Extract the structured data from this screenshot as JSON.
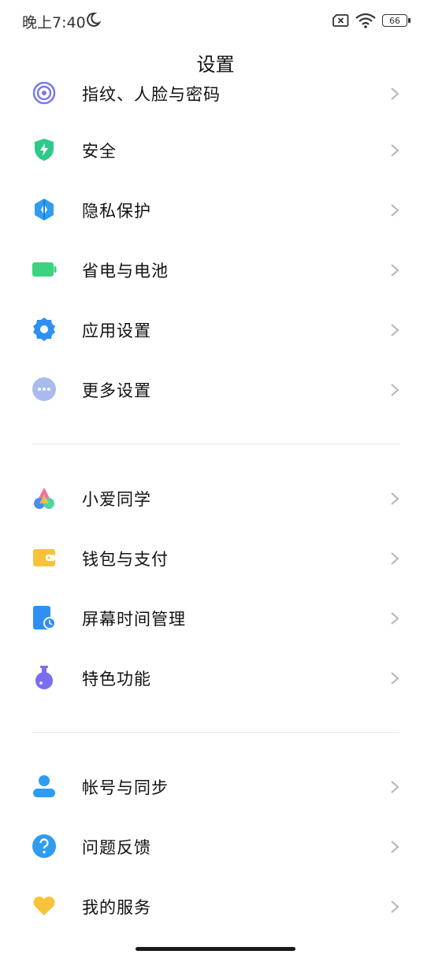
{
  "status_bar": {
    "time": "晚上7:40",
    "battery": "66"
  },
  "header": {
    "title": "设置"
  },
  "groups": [
    {
      "items": [
        {
          "label": "指纹、人脸与密码",
          "icon": "fingerprint-icon",
          "color": "#7a79e6"
        },
        {
          "label": "安全",
          "icon": "shield-icon",
          "color": "#2fc98a"
        },
        {
          "label": "隐私保护",
          "icon": "privacy-icon",
          "color": "#2f9cf0"
        },
        {
          "label": "省电与电池",
          "icon": "battery-icon",
          "color": "#3cd27f"
        },
        {
          "label": "应用设置",
          "icon": "gear-icon",
          "color": "#2f8ff2"
        },
        {
          "label": "更多设置",
          "icon": "more-icon",
          "color": "#9fb4ec"
        }
      ]
    },
    {
      "items": [
        {
          "label": "小爱同学",
          "icon": "xiaoai-icon",
          "color": "#5b8cf5"
        },
        {
          "label": "钱包与支付",
          "icon": "wallet-icon",
          "color": "#f9c23c"
        },
        {
          "label": "屏幕时间管理",
          "icon": "screen-time-icon",
          "color": "#2f8ff2"
        },
        {
          "label": "特色功能",
          "icon": "flask-icon",
          "color": "#7b6cf0"
        }
      ]
    },
    {
      "items": [
        {
          "label": "帐号与同步",
          "icon": "account-icon",
          "color": "#2f9cf0"
        },
        {
          "label": "问题反馈",
          "icon": "help-icon",
          "color": "#2f9cf0"
        },
        {
          "label": "我的服务",
          "icon": "heart-icon",
          "color": "#f9c23c"
        }
      ]
    }
  ]
}
